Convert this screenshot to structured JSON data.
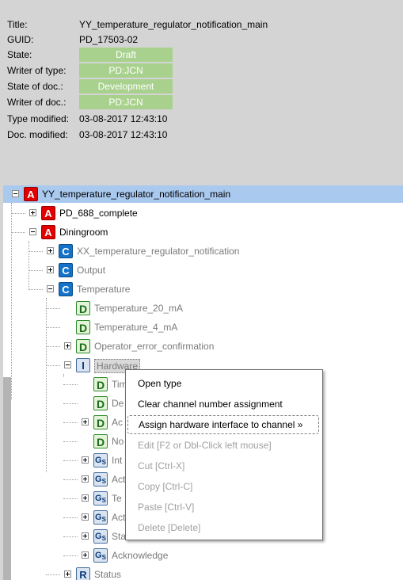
{
  "properties": [
    {
      "label": "Title:",
      "value": "YY_temperature_regulator_notification_main",
      "badge": false
    },
    {
      "label": "GUID:",
      "value": "PD_17503-02",
      "badge": false
    },
    {
      "label": "State:",
      "value": "Draft",
      "badge": true
    },
    {
      "label": "Writer of type:",
      "value": "PD:JCN",
      "badge": true
    },
    {
      "label": "State of doc.:",
      "value": "Development",
      "badge": true
    },
    {
      "label": "Writer of doc.:",
      "value": "PD:JCN",
      "badge": true
    },
    {
      "label": "Type modified:",
      "value": "03-08-2017 12:43:10",
      "badge": false
    },
    {
      "label": "Doc. modified:",
      "value": "03-08-2017 12:43:10",
      "badge": false
    }
  ],
  "colors": {
    "badge": "#a9d18e",
    "selection": "#a9c9ef",
    "panel": "#d4d4d4"
  },
  "tree": [
    {
      "label": "YY_temperature_regulator_notification_main",
      "icon": "A",
      "toggle": "minus",
      "dim": false,
      "selected": true
    },
    {
      "label": "PD_688_complete",
      "icon": "A",
      "toggle": "plus",
      "dim": false
    },
    {
      "label": "Diningroom",
      "icon": "A",
      "toggle": "minus",
      "dim": false
    },
    {
      "label": "XX_temperature_regulator_notification",
      "icon": "C",
      "toggle": "plus",
      "dim": true
    },
    {
      "label": "Output",
      "icon": "C",
      "toggle": "plus",
      "dim": true
    },
    {
      "label": "Temperature",
      "icon": "C",
      "toggle": "minus",
      "dim": true
    },
    {
      "label": "Temperature_20_mA",
      "icon": "D",
      "toggle": "none",
      "dim": true
    },
    {
      "label": "Temperature_4_mA",
      "icon": "D",
      "toggle": "none",
      "dim": true
    },
    {
      "label": "Operator_error_confirmation",
      "icon": "D",
      "toggle": "plus",
      "dim": true
    },
    {
      "label": "Hardware",
      "icon": "I",
      "toggle": "minus",
      "dim": true,
      "focused": true
    },
    {
      "label": "Tim",
      "icon": "D",
      "toggle": "none",
      "dim": true
    },
    {
      "label": "De",
      "icon": "D",
      "toggle": "none",
      "dim": true
    },
    {
      "label": "Ac",
      "icon": "D",
      "toggle": "plus",
      "dim": true
    },
    {
      "label": "No",
      "icon": "D",
      "toggle": "none",
      "dim": true
    },
    {
      "label": "Int",
      "icon": "GS",
      "toggle": "plus",
      "dim": true
    },
    {
      "label": "Act",
      "icon": "GS",
      "toggle": "plus",
      "dim": true
    },
    {
      "label": "Te",
      "icon": "GS",
      "toggle": "plus",
      "dim": true
    },
    {
      "label": "Act",
      "icon": "GS",
      "toggle": "plus",
      "dim": true
    },
    {
      "label": "Status",
      "icon": "GS",
      "toggle": "plus",
      "dim": true
    },
    {
      "label": "Acknowledge",
      "icon": "GS",
      "toggle": "plus",
      "dim": true
    },
    {
      "label": "Status",
      "icon": "R",
      "toggle": "plus",
      "dim": true
    }
  ],
  "context_menu": [
    {
      "label": "Open type",
      "enabled": true
    },
    {
      "label": "Clear channel number assignment",
      "enabled": true
    },
    {
      "label": "Assign hardware interface to channel »",
      "enabled": true,
      "focused": true
    },
    {
      "label": "Edit [F2 or Dbl-Click left mouse]",
      "enabled": false
    },
    {
      "label": "Cut [Ctrl-X]",
      "enabled": false
    },
    {
      "label": "Copy [Ctrl-C]",
      "enabled": false
    },
    {
      "label": "Paste [Ctrl-V]",
      "enabled": false
    },
    {
      "label": "Delete [Delete]",
      "enabled": false
    }
  ]
}
